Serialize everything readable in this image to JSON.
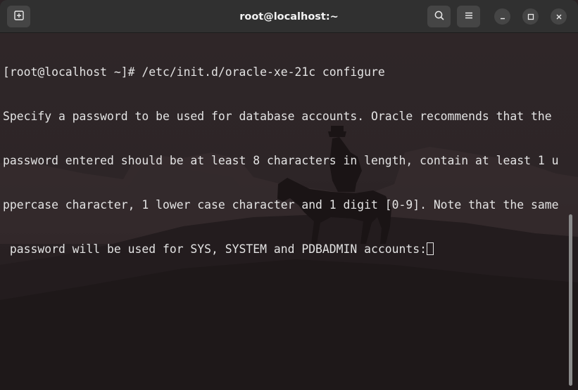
{
  "window": {
    "title": "root@localhost:~",
    "new_tab_icon": "new-tab-icon",
    "search_icon": "search-icon",
    "menu_icon": "hamburger-menu-icon",
    "minimize_icon": "minimize-icon",
    "maximize_icon": "maximize-icon",
    "close_icon": "close-icon"
  },
  "terminal": {
    "lines": [
      "[root@localhost ~]# /etc/init.d/oracle-xe-21c configure",
      "Specify a password to be used for database accounts. Oracle recommends that the",
      "password entered should be at least 8 characters in length, contain at least 1 u",
      "ppercase character, 1 lower case character and 1 digit [0-9]. Note that the same",
      " password will be used for SYS, SYSTEM and PDBADMIN accounts:"
    ],
    "text_color": "#e3e3e3",
    "background_color": "#2e2628"
  },
  "colors": {
    "header_bg": "#303030",
    "button_bg": "#454545"
  }
}
